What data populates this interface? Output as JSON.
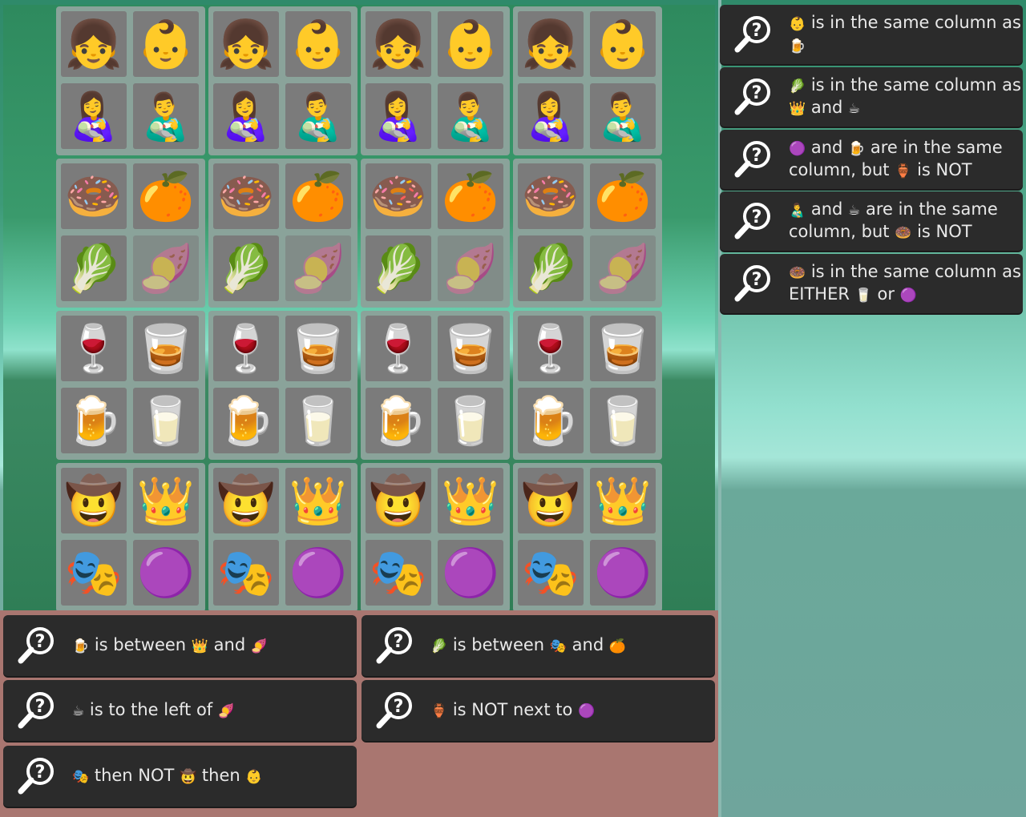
{
  "board": {
    "columns": 4,
    "categories": [
      {
        "name": "people",
        "items": [
          "👧",
          "👶",
          "👩‍🍼",
          "👨‍🍼"
        ]
      },
      {
        "name": "food",
        "items": [
          "🍩",
          "🍊",
          "🥬",
          "🍠"
        ]
      },
      {
        "name": "drinks",
        "items": [
          "🍷",
          "🥃",
          "🍺",
          "🥛"
        ]
      },
      {
        "name": "hats",
        "items": [
          "🤠",
          "👑",
          "🎭",
          "🟣"
        ]
      }
    ]
  },
  "right_clues": [
    {
      "icon": "magnifier-question-icon",
      "parts": [
        "👶",
        " is in the same column as ",
        "🍺"
      ]
    },
    {
      "icon": "magnifier-question-icon",
      "parts": [
        "🥬",
        " is in the same column as ",
        "👑",
        " and ",
        "☕"
      ]
    },
    {
      "icon": "magnifier-question-icon",
      "parts": [
        "🟣",
        " and ",
        "🍺",
        " are in the same column, but ",
        "🏺",
        " is NOT"
      ]
    },
    {
      "icon": "magnifier-question-icon",
      "parts": [
        "👨‍🍼",
        " and ",
        "☕",
        " are in the same column, but ",
        "🍩",
        " is NOT"
      ]
    },
    {
      "icon": "magnifier-question-icon",
      "parts": [
        "🍩",
        " is in the same column as EITHER ",
        "🥛",
        " or ",
        "🟣"
      ]
    }
  ],
  "bottom_clues": [
    {
      "icon": "magnifier-question-icon",
      "parts": [
        "🍺",
        " is between ",
        "👑",
        " and ",
        "🍠"
      ]
    },
    {
      "icon": "magnifier-question-icon",
      "parts": [
        "🥬",
        " is between ",
        "🎭",
        " and ",
        "🍊"
      ]
    },
    {
      "icon": "magnifier-question-icon",
      "parts": [
        "☕",
        " is to the left of ",
        "🍠"
      ]
    },
    {
      "icon": "magnifier-question-icon",
      "parts": [
        "🏺",
        " is NOT next to ",
        "🟣"
      ]
    },
    {
      "icon": "magnifier-question-icon",
      "parts": [
        "🎭",
        " then NOT ",
        "🤠",
        " then ",
        "👶"
      ]
    }
  ]
}
